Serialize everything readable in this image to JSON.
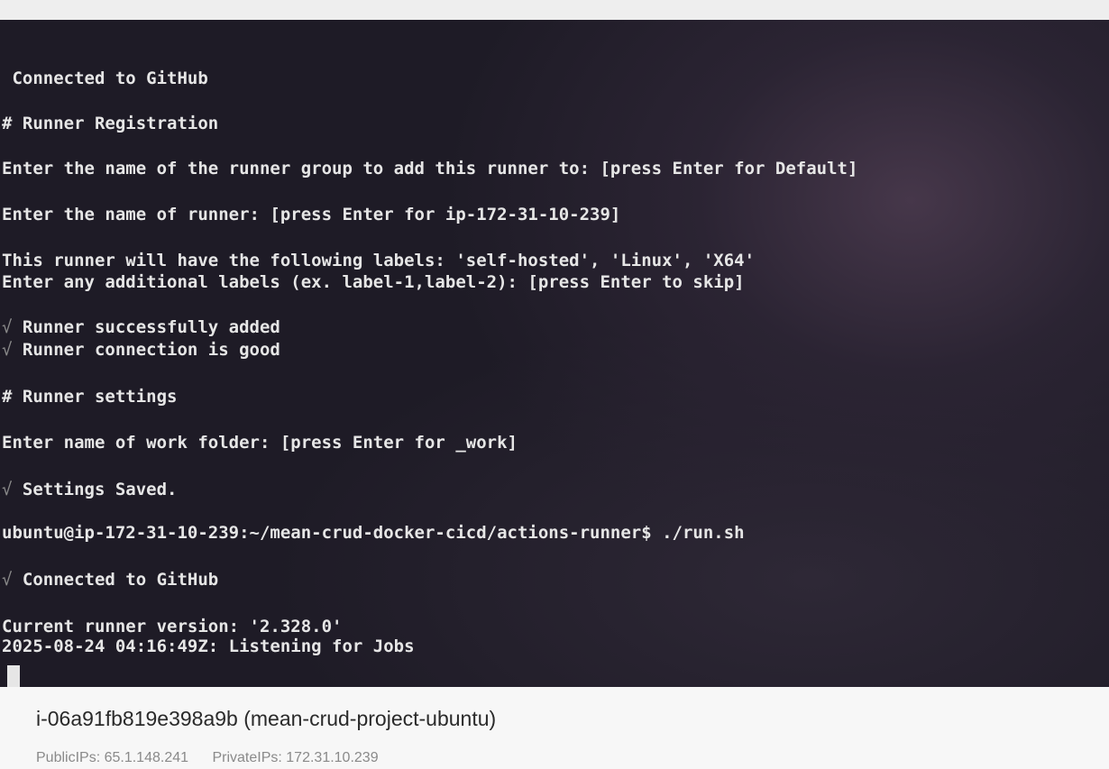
{
  "terminal": {
    "lines": [
      {
        "tick": "",
        "text": " Connected to GitHub"
      },
      {
        "tick": "",
        "text": "# Runner Registration"
      },
      {
        "tick": "",
        "text": "Enter the name of the runner group to add this runner to: [press Enter for Default]"
      },
      {
        "tick": "",
        "text": "Enter the name of runner: [press Enter for ip-172-31-10-239]"
      },
      {
        "tick": "",
        "text": "This runner will have the following labels: 'self-hosted', 'Linux', 'X64'"
      },
      {
        "tick": "",
        "text": "Enter any additional labels (ex. label-1,label-2): [press Enter to skip]"
      },
      {
        "tick": "√",
        "text": " Runner successfully added"
      },
      {
        "tick": "√",
        "text": " Runner connection is good"
      },
      {
        "tick": "",
        "text": "# Runner settings"
      },
      {
        "tick": "",
        "text": "Enter name of work folder: [press Enter for _work]"
      },
      {
        "tick": "√",
        "text": " Settings Saved."
      },
      {
        "tick": "",
        "text": "ubuntu@ip-172-31-10-239:~/mean-crud-docker-cicd/actions-runner$ ./run.sh"
      },
      {
        "tick": "√",
        "text": " Connected to GitHub"
      },
      {
        "tick": "",
        "text": "Current runner version: '2.328.0'"
      },
      {
        "tick": "",
        "text": "2025-08-24 04:16:49Z: Listening for Jobs"
      }
    ]
  },
  "instance": {
    "title": "i-06a91fb819e398a9b (mean-crud-project-ubuntu)",
    "public_ips": "PublicIPs: 65.1.148.241",
    "private_ips": "PrivateIPs: 172.31.10.239"
  },
  "colors": {
    "terminal_bg": "#1e1b26",
    "terminal_text": "#e6e6e6",
    "panel_bg": "#f7f7f7"
  }
}
